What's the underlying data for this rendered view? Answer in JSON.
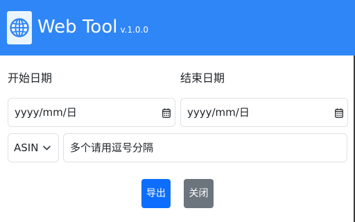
{
  "header": {
    "title": "Web Tool",
    "version": "v.1.0.0",
    "logo_icon": "globe-icon",
    "background": "#2f86f6"
  },
  "form": {
    "start_date_label": "开始日期",
    "end_date_label": "结束日期",
    "start_date_value": "yyyy/mm/日",
    "end_date_value": "yyyy/mm/日",
    "date_icon": "calendar-icon",
    "id_type_selected": "ASIN",
    "ids_placeholder": "多个请用逗号分隔"
  },
  "actions": {
    "export_label": "导出",
    "close_label": "关闭",
    "primary_color": "#0d6efd",
    "secondary_color": "#6c757d"
  }
}
